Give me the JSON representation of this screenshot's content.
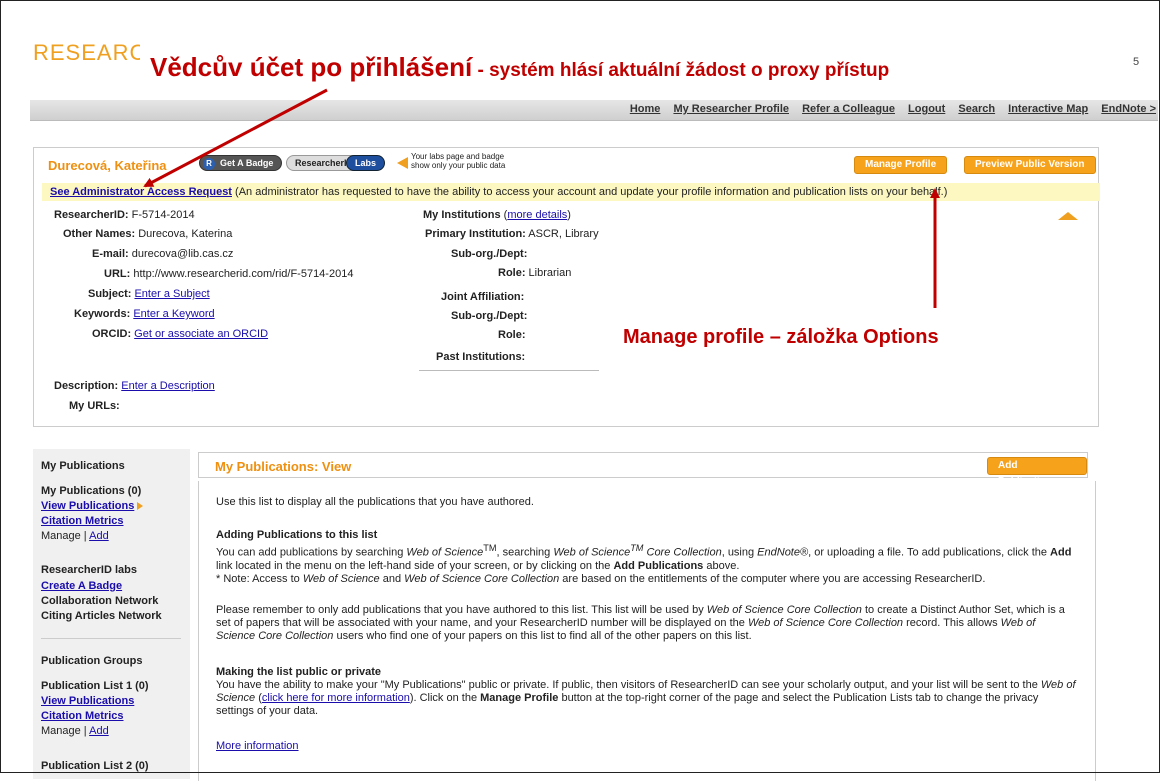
{
  "header": {
    "logo": "RESEARC",
    "overlay_title_big": "Vědcův účet po přihlášení",
    "overlay_title_small": " - systém hlásí aktuální žádost o proxy přístup",
    "corner_num": "5",
    "nav": [
      "Home",
      "My Researcher Profile",
      "Refer a Colleague",
      "Logout",
      "Search",
      "Interactive Map",
      "EndNote >"
    ]
  },
  "profile": {
    "name": "Durecová, Kateřina",
    "badge_r": "R",
    "badge_label": "Get A Badge",
    "researcherid_pill": "ResearcherID",
    "labs_pill": "Labs",
    "labs_note_1": "Your labs page and badge",
    "labs_note_2": "show only your public data",
    "manage_btn": "Manage Profile",
    "preview_btn": "Preview Public Version",
    "alert_link": "See Administrator Access Request",
    "alert_text": " (An administrator has requested to have the ability to access your account and update your profile information and publication lists on your behalf.)",
    "left_fields": [
      {
        "label": "ResearcherID:",
        "value": " F-5714-2014",
        "link": false
      },
      {
        "label": "Other Names:",
        "value": " Durecova, Katerina",
        "link": false
      },
      {
        "label": "E-mail:",
        "value": " durecova@lib.cas.cz",
        "link": false
      },
      {
        "label": "URL:",
        "value": " http://www.researcherid.com/rid/F-5714-2014",
        "link": false
      },
      {
        "label": "Subject:",
        "value": "Enter a Subject",
        "link": true
      },
      {
        "label": "Keywords:",
        "value": "Enter a Keyword",
        "link": true
      },
      {
        "label": "ORCID:",
        "value": "Get or associate an ORCID",
        "link": true
      }
    ],
    "my_institutions_label": "My Institutions",
    "more_details": "more details",
    "right_fields": [
      {
        "label": "Primary Institution:",
        "value": " ASCR, Library"
      },
      {
        "label": "Sub-org./Dept:",
        "value": ""
      },
      {
        "label": "Role:",
        "value": " Librarian"
      },
      {
        "label": "Joint Affiliation:",
        "value": ""
      },
      {
        "label": "Sub-org./Dept:",
        "value": ""
      },
      {
        "label": "Role:",
        "value": ""
      },
      {
        "label": "Past Institutions:",
        "value": ""
      }
    ],
    "description_label": "Description:",
    "description_link": "Enter a Description",
    "urls_label": "My URLs:",
    "overlay_manage": "Manage profile – záložka Options"
  },
  "sidebar": {
    "my_pubs_head": "My Publications",
    "my_pubs_count": "My Publications (0)",
    "view_pubs": "View Publications",
    "citation_metrics": "Citation Metrics",
    "manage": "Manage | ",
    "add": "Add",
    "labs_head": "ResearcherID labs",
    "create_badge": "Create A Badge",
    "collab_net": "Collaboration Network",
    "citing_net": "Citing Articles Network",
    "groups_head": "Publication Groups",
    "list1": "Publication List 1 (0)",
    "view_pubs_2": "View Publications",
    "citation_metrics_2": "Citation Metrics",
    "list2": "Publication List 2 (0)"
  },
  "main": {
    "title": "My Publications: View",
    "add_btn": "Add Publications",
    "p1": "Use this list to display all the publications that you have authored.",
    "h2": "Adding Publications to this list",
    "p2a": "You can add publications by searching ",
    "wos": "Web of Science",
    "tm": "TM",
    "p2b": ", searching ",
    "wos_core": "Web of Science",
    "tm2": "TM",
    "p2c": " Core Collection",
    "p2d": ", using ",
    "endnote": "EndNote®",
    "p2e": ", or uploading a file. To add publications, click the",
    "p2f_b": "Add",
    "p2f": " link located in the menu on the left-hand side of your screen, or by clicking on the ",
    "p2g_b": "Add Publications",
    "p2g": " above.",
    "p2h": "* Note: Access to ",
    "p2i": "Web of Science",
    "p2j": " and ",
    "p2k": "Web of Science Core Collection",
    "p2l": " are based on the entitlements of the computer where you are accessing ResearcherID.",
    "p3a": "Please remember to only add publications that you have authored to this list. This list will be used by ",
    "p3b": "Web of Science Core Collection",
    "p3c": " to create a Distinct Author Set, which is a set of papers that will be associated with your name, and your ResearcherID number will be displayed on the ",
    "p3d": "Web of Science Core Collection",
    "p3e": " record. This allows ",
    "p3f": "Web of Science Core Collection",
    "p3g": " users who find one of your papers on this list to find all of the other papers on this list.",
    "h4": "Making the list public or private",
    "p4a": "You have the ability to make your \"My Publications\" public or private. If public, then visitors of ResearcherID can see your scholarly output, and your list will be sent to the ",
    "p4b": "Web of Science",
    "p4c": " (",
    "p4d": "click here for more information",
    "p4e": "). Click on the ",
    "p4f": "Manage Profile",
    "p4g": " button at the top-right corner of the page and select the Publication Lists tab to change the privacy settings of your data.",
    "more_info": "More information"
  },
  "colors": {
    "accent": "#f7a21b",
    "annotation": "#c00000",
    "link": "#1a0dab",
    "alert_bg": "#fdf8c2"
  }
}
